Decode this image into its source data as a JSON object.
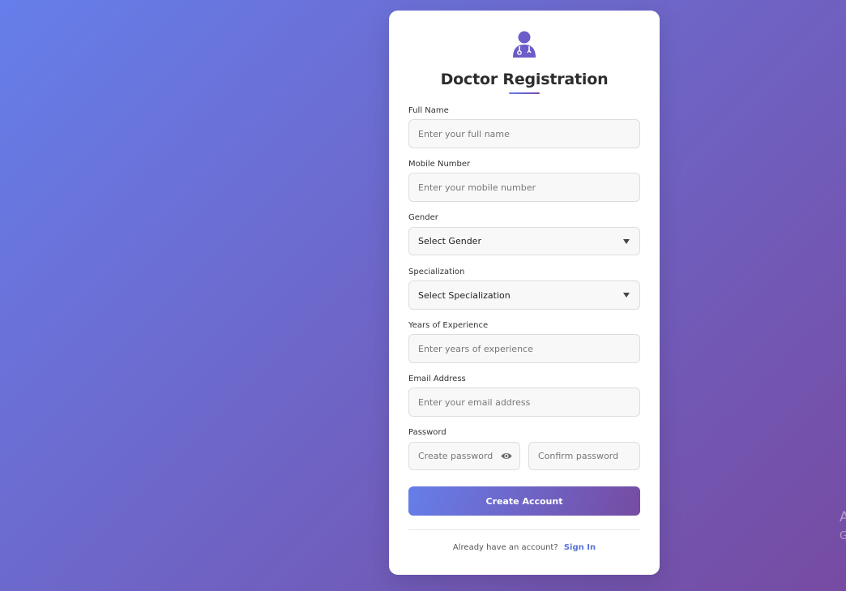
{
  "form": {
    "title": "Doctor Registration",
    "fields": {
      "full_name": {
        "label": "Full Name",
        "placeholder": "Enter your full name"
      },
      "mobile": {
        "label": "Mobile Number",
        "placeholder": "Enter your mobile number"
      },
      "gender": {
        "label": "Gender",
        "selected": "Select Gender"
      },
      "specialization": {
        "label": "Specialization",
        "selected": "Select Specialization"
      },
      "experience": {
        "label": "Years of Experience",
        "placeholder": "Enter years of experience"
      },
      "email": {
        "label": "Email Address",
        "placeholder": "Enter your email address"
      },
      "password": {
        "label": "Password",
        "create_placeholder": "Create password",
        "confirm_placeholder": "Confirm password"
      }
    },
    "submit_label": "Create Account",
    "footer": {
      "text": "Already have an account?",
      "link": "Sign In"
    }
  },
  "background_edge_text": [
    "A",
    "G"
  ],
  "colors": {
    "gradient_start": "#667eea",
    "gradient_end": "#764ba2",
    "link": "#5b73d6"
  },
  "icons": {
    "header": "doctor-icon",
    "caret": "chevron-down-icon",
    "password_toggle": "eye-icon"
  }
}
